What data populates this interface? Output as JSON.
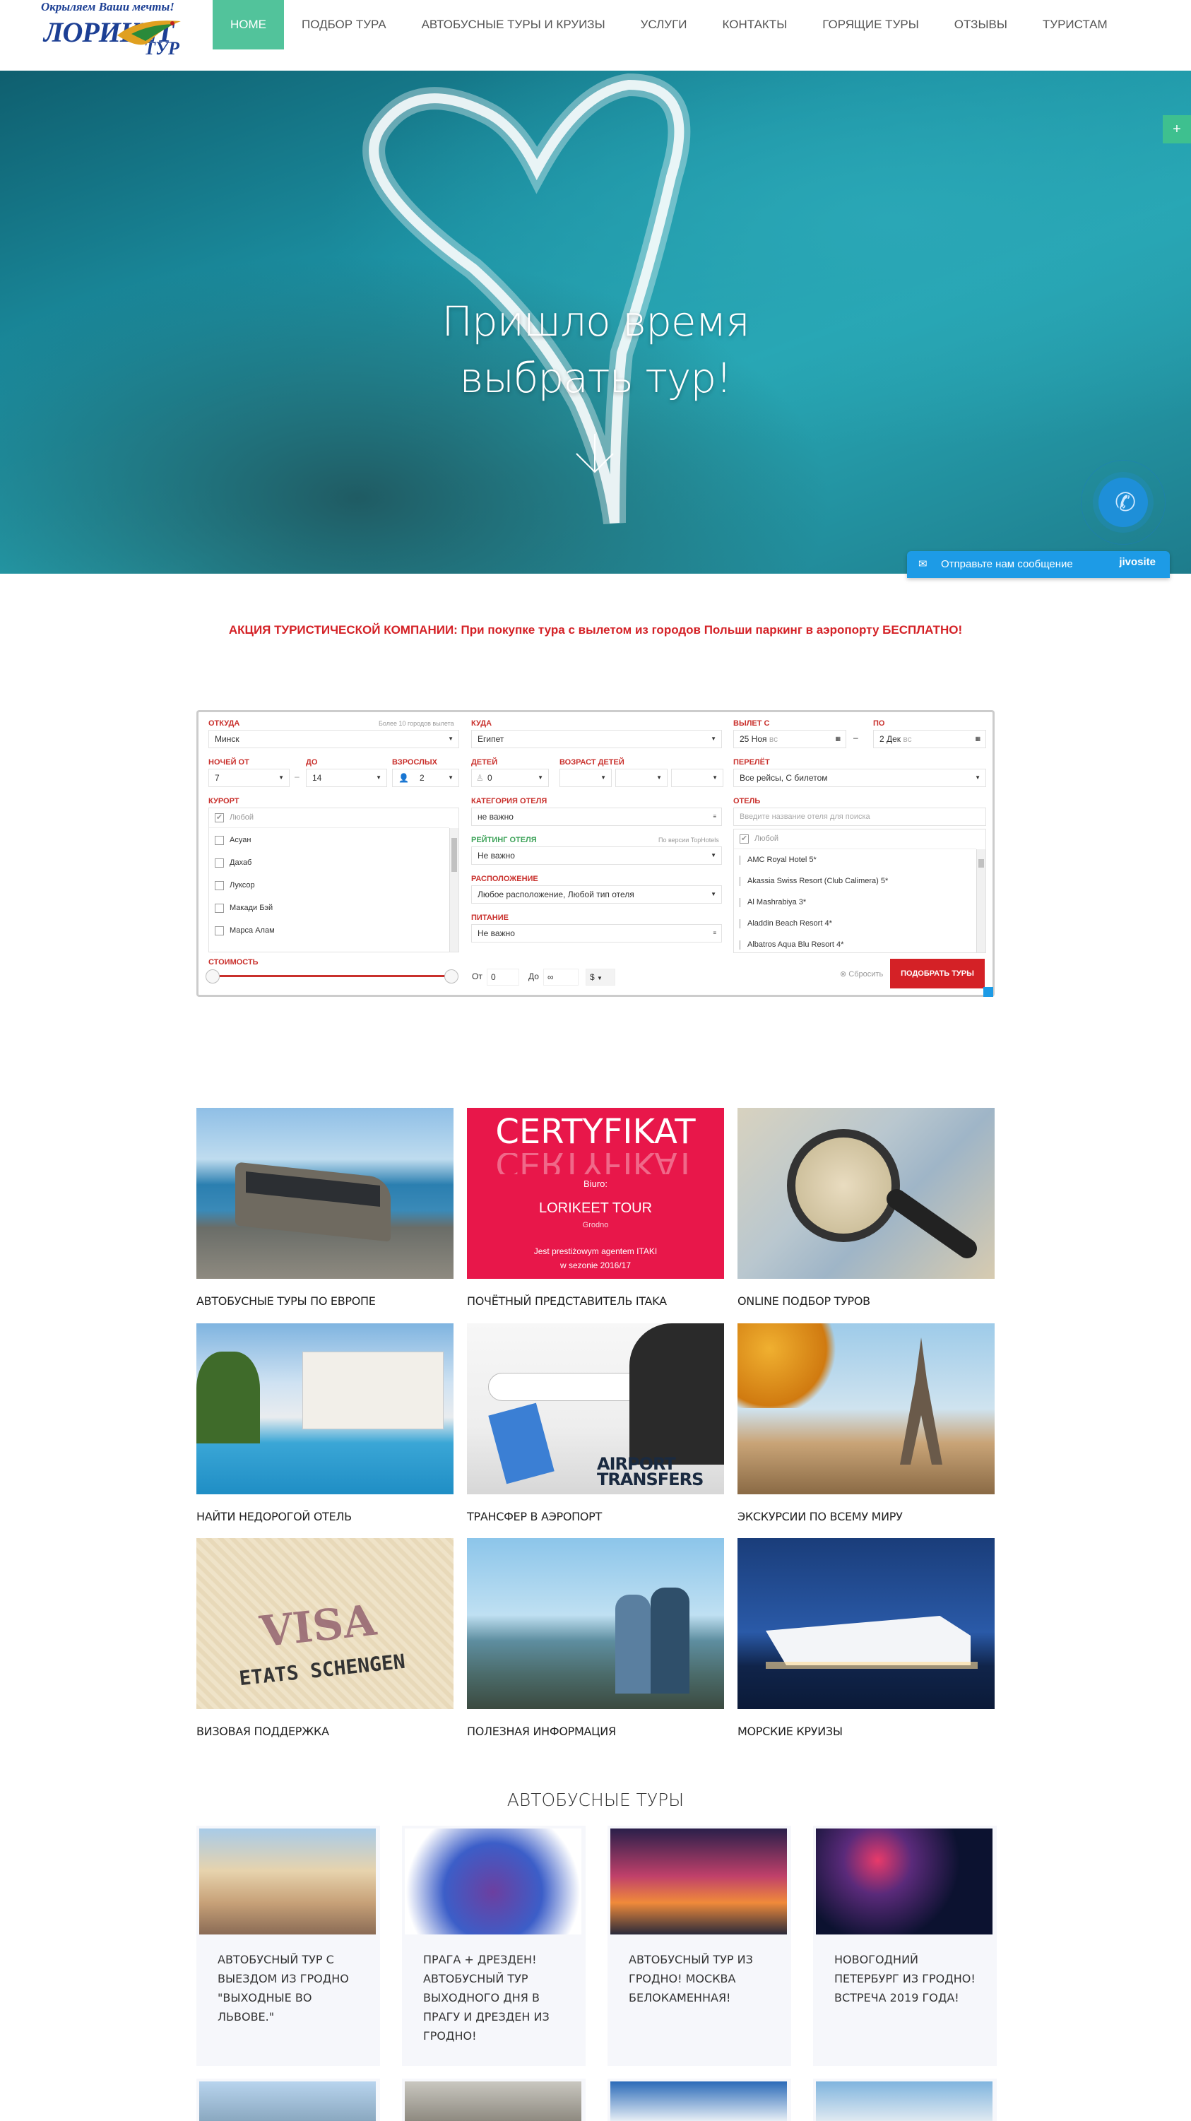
{
  "header": {
    "logo": {
      "tagline": "Окрыляем Ваши мечты!",
      "name": "ЛОРИКЕТ",
      "name_suffix": "ТУР"
    },
    "nav": [
      "Home",
      "Подбор тура",
      "Автобусные туры и круизы",
      "Услуги",
      "Контакты",
      "Горящие туры",
      "Отзывы",
      "Туристам"
    ]
  },
  "hero": {
    "title_line1": "Пришло время",
    "title_line2": "выбрать тур!",
    "side_button": "+",
    "jivo_message": "Отправьте нам сообщение",
    "jivo_brand": "jivosite"
  },
  "promo": "АКЦИЯ ТУРИСТИЧЕСКОЙ КОМПАНИИ: При покупке тура с вылетом из городов Польши паркинг в аэропорту БЕСПЛАТНО!",
  "search": {
    "from_label": "Откуда",
    "from_hint": "Более 10 городов вылета",
    "from_value": "Минск",
    "to_label": "Куда",
    "to_value": "Египет",
    "depart_label": "Вылет с",
    "depart_value": "25 Ноя",
    "depart_day": "вс",
    "till_label": "по",
    "till_value": "2 Дек",
    "till_day": "вс",
    "date_dash": "–",
    "nights_from_label": "Ночей от",
    "nights_from_value": "7",
    "nights_to_label": "до",
    "nights_to_value": "14",
    "nights_dash": "–",
    "adults_label": "Взрослых",
    "adults_value": "2",
    "children_label": "Детей",
    "children_value": "0",
    "child_age_label": "Возраст детей",
    "flight_label": "Перелёт",
    "flight_value": "Все рейсы, С билетом",
    "resort_label": "Курорт",
    "resort_any": "Любой",
    "resorts": [
      "Асуан",
      "Дахаб",
      "Луксор",
      "Макади Бэй",
      "Марса Алам"
    ],
    "hotel_cat_label": "Категория отеля",
    "hotel_cat_value": "не важно",
    "rating_label": "Рейтинг отеля",
    "rating_hint": "По версии TopHotels",
    "rating_value": "Не важно",
    "location_label": "Расположение",
    "location_value": "Любое расположение, Любой тип отеля",
    "meal_label": "Питание",
    "meal_value": "Не важно",
    "hotel_label": "Отель",
    "hotel_placeholder": "Введите название отеля для поиска",
    "hotel_any": "Любой",
    "hotels": [
      "AMC Royal Hotel 5*",
      "Akassia Swiss Resort (Club Calimera) 5*",
      "Al Mashrabiya 3*",
      "Aladdin Beach Resort 4*",
      "Albatros Aqua Blu Resort 4*"
    ],
    "price_label": "Стоимость",
    "price_from_label": "От",
    "price_from_value": "0",
    "price_to_label": "До",
    "price_to_value": "∞",
    "currency": "$",
    "reset": "Сбросить",
    "submit": "Подобрать туры"
  },
  "cards": [
    {
      "title": "Автобусные туры по Европе"
    },
    {
      "title": "Почётный представитель ITAKA",
      "cert_title": "CERTYFIKAT",
      "cert_line1": "Biuro:",
      "cert_line2": "LORIKEET TOUR",
      "cert_line3": "Grodno",
      "cert_line4": "Jest prestiżowym agentem ITAKI",
      "cert_line5": "w sezonie 2016/17"
    },
    {
      "title": "Online подбор туров"
    },
    {
      "title": "Найти недорогой отель"
    },
    {
      "title": "Трансфер в аэропорт",
      "img_text1": "AIRPORT",
      "img_text2": "TRANSFERS"
    },
    {
      "title": "Экскурсии по всему миру"
    },
    {
      "title": "Визовая поддержка",
      "img_text1": "VISA",
      "img_text2": "ETATS SCHENGEN"
    },
    {
      "title": "Полезная информация"
    },
    {
      "title": "Морские круизы"
    }
  ],
  "bus_section_title": "Автобусные туры",
  "bus_tours": [
    {
      "title": "Автобусный тур с выездом из Гродно \"Выходные во Львове.\""
    },
    {
      "title": "Прага + Дрезден! Автобусный тур выходного дня в Прагу и Дрезден из Гродно!"
    },
    {
      "title": "Автобусный тур из Гродно! Москва Белокаменная!"
    },
    {
      "title": "Новогодний Петербург из Гродно! Встреча 2019 года!"
    }
  ],
  "colors": {
    "accent": "#52c39b",
    "brand": "#1c3f94",
    "promo": "#d42126",
    "jivo": "#1d9be6"
  }
}
